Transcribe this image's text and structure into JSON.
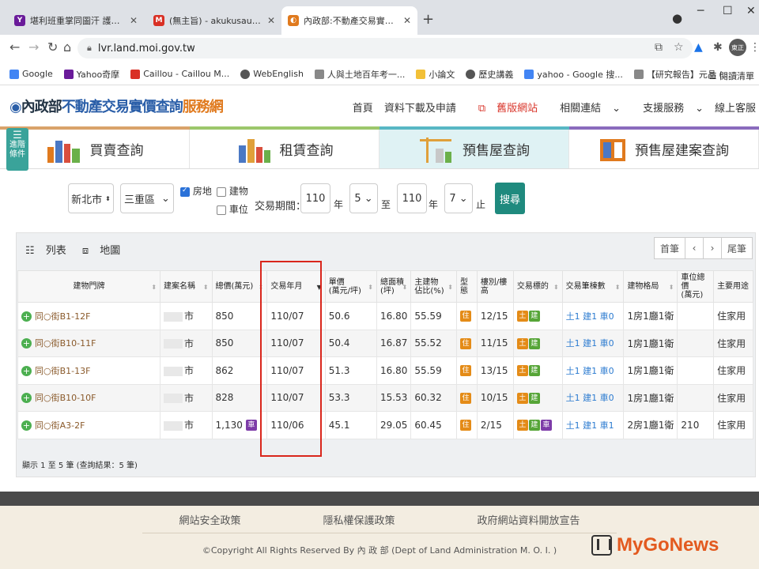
{
  "browser": {
    "tabs": [
      {
        "title": "堪利班重掌同圖汗 護衛紛飛遊戲",
        "fav_color": "#6a1b9a",
        "fav_text": "Y"
      },
      {
        "title": "(無主旨) - akukusau@gmail.com",
        "fav_color": "#d93025",
        "fav_text": "M"
      },
      {
        "title": "內政部:不動產交易實價查詢服務",
        "fav_color": "#e07a1e",
        "fav_text": "◐"
      }
    ],
    "new_tab": "+",
    "url": "lvr.land.moi.gov.tw",
    "avatar": "東正",
    "bookmarks": [
      {
        "label": "Google",
        "color": "#4285f4"
      },
      {
        "label": "Yahoo奇摩",
        "color": "#6a1b9a"
      },
      {
        "label": "Caillou - Caillou M...",
        "color": "#d93025"
      },
      {
        "label": "WebEnglish",
        "color": "#555555"
      },
      {
        "label": "人與土地百年考一...",
        "color": "#888888"
      },
      {
        "label": "小論文",
        "color": "#f2c037"
      },
      {
        "label": "歷史講義",
        "color": "#555555"
      },
      {
        "label": "yahoo - Google 搜...",
        "color": "#4285f4"
      },
      {
        "label": "【研究報告】元晶 (...",
        "color": "#888888"
      }
    ],
    "reading_list": "閱讀清單"
  },
  "site": {
    "logo_moi": "內政部",
    "logo_title": "不動產交易實價查詢",
    "logo_service": "服務網",
    "nav": [
      "首頁",
      "資料下載及申請",
      "舊版網站",
      "相關連結",
      "支援服務",
      "線上客服"
    ],
    "adv_button": "進階條件",
    "big_tabs": [
      "買賣查詢",
      "租賃查詢",
      "預售屋查詢",
      "預售屋建案查詢"
    ],
    "colorbar": [
      "#d9a36a",
      "#9cc76b",
      "#58b7c4",
      "#8a6bbd"
    ]
  },
  "filter": {
    "city": "新北市",
    "district": "三重區",
    "opt_land": "房地",
    "opt_building": "建物",
    "opt_parking": "車位",
    "period_label": "交易期間：",
    "from_year": "110",
    "year_unit": "年",
    "from_month": "5",
    "to_label": "至",
    "to_year": "110",
    "to_month": "7",
    "end_label": "止",
    "search": "搜尋"
  },
  "results": {
    "list_view": "列表",
    "map_view": "地圖",
    "pager": [
      "首筆",
      "‹",
      "›",
      "尾筆"
    ],
    "headers": [
      "建物門牌",
      "建案名稱",
      "總價(萬元)",
      "交易年月",
      "單價\n(萬元/坪)",
      "總面積\n(坪)",
      "主建物\n佔比(%)",
      "型態",
      "樓別/樓高",
      "交易標的",
      "交易筆棟數",
      "建物格局",
      "車位總價\n(萬元)",
      "主要用途"
    ],
    "rows": [
      {
        "addr": "同○街B1-12F",
        "name": "市",
        "total": "850",
        "parking_badge": "",
        "date": "110/07",
        "unit": "50.6",
        "area": "16.80",
        "ratio": "55.59",
        "type": "住",
        "floor": "12/15",
        "target": [
          "土",
          "建"
        ],
        "counts": "土1 建1 車0",
        "layout": "1房1廳1衛",
        "parking_price": "",
        "use": "住家用"
      },
      {
        "addr": "同○街B10-11F",
        "name": "市",
        "total": "850",
        "parking_badge": "",
        "date": "110/07",
        "unit": "50.4",
        "area": "16.87",
        "ratio": "55.52",
        "type": "住",
        "floor": "11/15",
        "target": [
          "土",
          "建"
        ],
        "counts": "土1 建1 車0",
        "layout": "1房1廳1衛",
        "parking_price": "",
        "use": "住家用"
      },
      {
        "addr": "同○街B1-13F",
        "name": "市",
        "total": "862",
        "parking_badge": "",
        "date": "110/07",
        "unit": "51.3",
        "area": "16.80",
        "ratio": "55.59",
        "type": "住",
        "floor": "13/15",
        "target": [
          "土",
          "建"
        ],
        "counts": "土1 建1 車0",
        "layout": "1房1廳1衛",
        "parking_price": "",
        "use": "住家用"
      },
      {
        "addr": "同○街B10-10F",
        "name": "市",
        "total": "828",
        "parking_badge": "",
        "date": "110/07",
        "unit": "53.3",
        "area": "15.53",
        "ratio": "60.32",
        "type": "住",
        "floor": "10/15",
        "target": [
          "土",
          "建"
        ],
        "counts": "土1 建1 車0",
        "layout": "1房1廳1衛",
        "parking_price": "",
        "use": "住家用"
      },
      {
        "addr": "同○街A3-2F",
        "name": "市",
        "total": "1,130",
        "parking_badge": "車",
        "date": "110/06",
        "unit": "45.1",
        "area": "29.05",
        "ratio": "60.45",
        "type": "住",
        "floor": "2/15",
        "target": [
          "土",
          "建",
          "車"
        ],
        "counts": "土1 建1 車1",
        "layout": "2房1廳1衛",
        "parking_price": "210",
        "use": "住家用"
      }
    ],
    "summary": "顯示 1 至 5 筆 (查詢結果：5 筆)"
  },
  "footer": {
    "links": [
      "網站安全政策",
      "隱私權保護政策",
      "政府網站資料開放宣告"
    ],
    "copyright": "©Copyright All Rights Reserved By 內 政 部 (Dept of Land Administration M. O. I. )",
    "watermark": "MyGoNews"
  },
  "colors": {
    "accent": "#1f8a7e",
    "highlight": "#d9261c",
    "selected_tab": "#dff2f4"
  }
}
